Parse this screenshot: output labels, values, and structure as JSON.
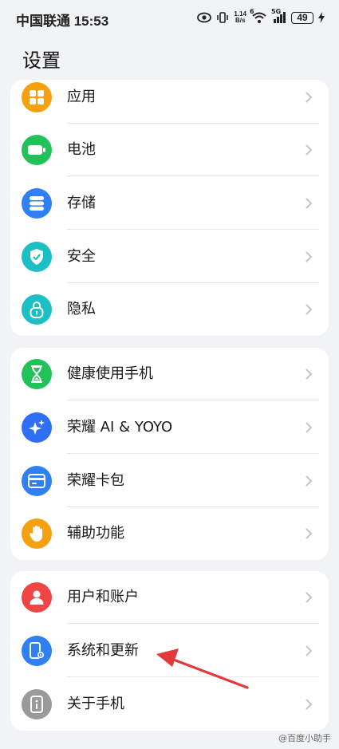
{
  "status_bar": {
    "carrier_time": "中国联通 15:53",
    "net_speed_value": "1.14",
    "net_speed_unit": "B/s",
    "wifi_tag": "6",
    "signal_tag": "5G",
    "battery": "49",
    "icons": [
      "eye-icon",
      "vibrate-icon",
      "wifi-icon",
      "signal-icon",
      "battery-icon",
      "charging-icon"
    ]
  },
  "page": {
    "title": "设置"
  },
  "groups": [
    {
      "items": [
        {
          "label": "应用",
          "icon": "apps-icon",
          "color": "#f5a10f"
        },
        {
          "label": "电池",
          "icon": "battery-icon",
          "color": "#22c15a"
        },
        {
          "label": "存储",
          "icon": "storage-icon",
          "color": "#2f7ff5"
        },
        {
          "label": "安全",
          "icon": "shield-icon",
          "color": "#1cbfc4"
        },
        {
          "label": "隐私",
          "icon": "lock-icon",
          "color": "#1cbfc4"
        }
      ]
    },
    {
      "items": [
        {
          "label": "健康使用手机",
          "icon": "hourglass-icon",
          "color": "#22c15a"
        },
        {
          "label": "荣耀 AI & YOYO",
          "icon": "sparkle-icon",
          "color": "#2f6ff5"
        },
        {
          "label": "荣耀卡包",
          "icon": "wallet-icon",
          "color": "#2f7ff5"
        },
        {
          "label": "辅助功能",
          "icon": "hand-icon",
          "color": "#f5a10f"
        }
      ]
    },
    {
      "items": [
        {
          "label": "用户和账户",
          "icon": "user-icon",
          "color": "#f04545"
        },
        {
          "label": "系统和更新",
          "icon": "phone-settings-icon",
          "color": "#2f7ff5"
        },
        {
          "label": "关于手机",
          "icon": "info-icon",
          "color": "#9a9a9a"
        }
      ]
    }
  ],
  "watermark": "@百度小助手"
}
